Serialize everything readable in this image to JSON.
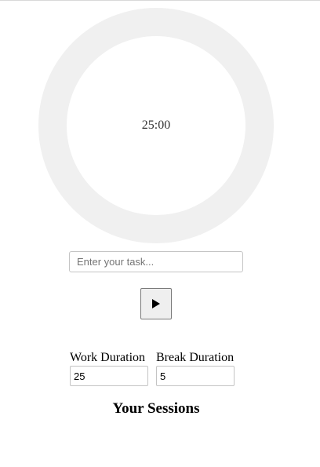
{
  "timer": {
    "display": "25:00"
  },
  "task": {
    "placeholder": "Enter your task...",
    "value": ""
  },
  "controls": {
    "play_icon": "play-icon"
  },
  "settings": {
    "work_label": "Work Duration",
    "work_value": "25",
    "break_label": "Break Duration",
    "break_value": "5"
  },
  "sessions": {
    "heading": "Your Sessions"
  },
  "colors": {
    "ring": "#f0f0f0",
    "timer_text": "#333333"
  }
}
